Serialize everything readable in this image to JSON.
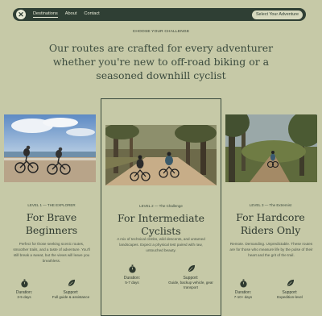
{
  "nav": {
    "links": [
      "Destinations",
      "About",
      "Contact"
    ],
    "cta": "Select Your Adventure"
  },
  "eyebrow": "CHOOSE YOUR CHALLENGE",
  "headline": "Our routes are crafted for every adventurer whether you're new to off-road biking or a seasoned downhill cyclist",
  "cards": [
    {
      "level": "LEVEL 1 — THE EXPLORER",
      "title": "For Brave Beginners",
      "desc": "Perfect for those seeking scenic routes, smoother trails, and a taste of adventure. You'll still break a sweat, but the views will leave you breathless.",
      "duration_label": "Duration:",
      "duration_value": "3-5 days",
      "support_label": "Support:",
      "support_value": "Full guide & assistance"
    },
    {
      "level": "LEVEL 2 — The Challenge",
      "title": "For Intermediate Cyclists",
      "desc": "A mix of technical climbs, wild descents, and untamed landscapes. Expect a physical test paired with raw, untouched beauty.",
      "duration_label": "Duration:",
      "duration_value": "5-7 days",
      "support_label": "Support:",
      "support_value": "Guide, backup vehicle, gear transport"
    },
    {
      "level": "LEVEL 3 — The Extremist",
      "title": "For Hardcore Riders Only",
      "desc": "Remote. Demanding. Unpredictable. These routes are for those who measure life by the pulse of their heart and the grit of the trail.",
      "duration_label": "Duration:",
      "duration_value": "7-10+ days",
      "support_label": "Support:",
      "support_value": "Expedition-level"
    }
  ],
  "colors": {
    "background": "#c6c9a7",
    "nav": "#2f3f34",
    "text": "#2f3a30"
  }
}
